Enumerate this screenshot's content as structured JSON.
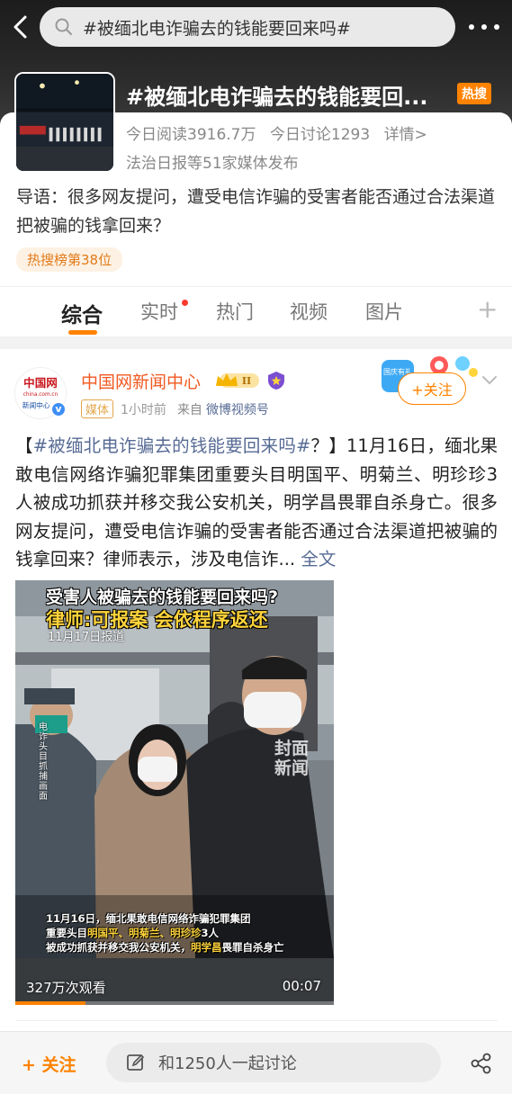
{
  "search": {
    "query": "#被缅北电诈骗去的钱能要回来吗#"
  },
  "topic": {
    "title": "#被缅北电诈骗去的钱能要回...",
    "hot_badge": "热搜",
    "reads": "今日阅读3916.7万",
    "discussions": "今日讨论1293",
    "details_link": "详情>",
    "publisher": "法治日报等51家媒体发布",
    "intro": "导语：很多网友提问，遭受电信诈骗的受害者能否通过合法渠道把被骗的钱拿回来？",
    "rank": "热搜榜第38位",
    "thumb_caption": "法治日报"
  },
  "tabs": [
    {
      "label": "综合",
      "active": true
    },
    {
      "label": "实时",
      "active": false,
      "red_dot": true
    },
    {
      "label": "热门",
      "active": false
    },
    {
      "label": "视频",
      "active": false
    },
    {
      "label": "图片",
      "active": false
    }
  ],
  "tab_plus": "+",
  "post": {
    "author": "中国网新闻中心",
    "avatar_text_top": "中国网",
    "avatar_text_url": "china.com.cn",
    "avatar_text_bottom": "新闻中心",
    "media_tag": "媒体",
    "time": "1小时前",
    "source_prefix": "来自",
    "source_app": "微博视频号",
    "follow_label": "+关注",
    "festival_label": "国庆有礼",
    "text_open": "【",
    "hashtag": "#被缅北电诈骗去的钱能要回来吗#",
    "text_body": "？】11月16日，缅北果敢电信网络诈骗犯罪集团重要头目明国平、明菊兰、明珍珍3人被成功抓获并移交我公安机关，明学昌畏罪自杀身亡。很多网友提问，遭受电信诈骗的受害者能否通过合法渠道把被骗的钱拿回来？律师表示，涉及电信诈...",
    "full_text_link": "全文"
  },
  "video": {
    "headline1": "受害人被骗去的钱能要回来吗?",
    "headline2": "律师:可报案 会依程序返还",
    "date": "11月17日报道",
    "side_text": "电诈头目抓捕画面",
    "watermark": "封面新闻",
    "caption_line1": "11月16日，缅北果敢电信网络诈骗犯罪集团",
    "caption_line2_prefix": "重要头目",
    "caption_line2_names": "明国平、明菊兰、明珍珍",
    "caption_line2_suffix": "3人",
    "caption_line3_prefix": "被成功抓获并移交我公安机关，",
    "caption_line3_name": "明学昌",
    "caption_line3_suffix": "畏罪自杀身亡",
    "views": "327万次观看",
    "duration": "00:07",
    "progress": 0.22
  },
  "bottom": {
    "follow_label": "+ 关注",
    "comment_placeholder": "和1250人一起讨论"
  },
  "colors": {
    "accent": "#ff8200",
    "link": "#576b95",
    "author": "#f15a22"
  },
  "icons": [
    "back-arrow-icon",
    "search-icon",
    "more-icon",
    "edit-icon",
    "share-icon",
    "chevron-down-icon",
    "crown-icon",
    "shield-icon",
    "verified-icon"
  ]
}
